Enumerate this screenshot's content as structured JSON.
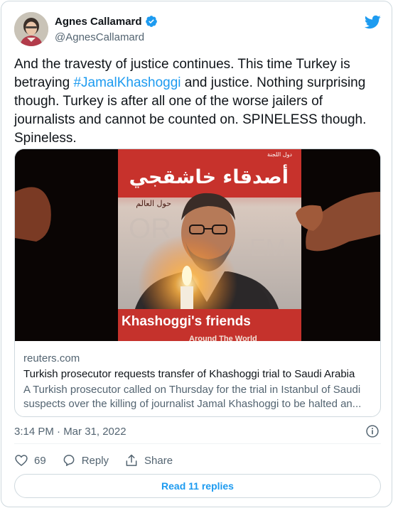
{
  "author": {
    "name": "Agnes Callamard",
    "handle": "@AgnesCallamard",
    "verified": true
  },
  "tweet": {
    "text_part1": "And the travesty of justice continues. This time Turkey is betraying ",
    "hashtag": "#JamalKhashoggi",
    "text_part2": " and justice. Nothing surprising though. Turkey is after all one of the worse jailers of journalists and cannot be counted on.  SPINELESS though. Spineless."
  },
  "link_card": {
    "photo": {
      "poster_arabic_title": "أصدقاء خاشقجي",
      "poster_arabic_sub": "حول العالم",
      "poster_arabic_top": "دول اللجنة",
      "poster_english_title": "Khashoggi's friends",
      "poster_english_sub": "Around The World"
    },
    "domain": "reuters.com",
    "title": "Turkish prosecutor requests transfer of Khashoggi trial to Saudi Arabia",
    "description_line1": "A Turkish prosecutor called on Thursday for the trial in Istanbul of Saudi",
    "description_line2": "suspects over the killing of journalist Jamal Khashoggi to be halted an..."
  },
  "timestamp": "3:14 PM · Mar 31, 2022",
  "actions": {
    "like_count": "69",
    "reply_label": "Reply",
    "share_label": "Share"
  },
  "read_replies_label": "Read 11 replies",
  "colors": {
    "accent": "#1d9bf0",
    "secondary_text": "#536471",
    "border": "#cfd9de"
  },
  "icons": [
    "verified-badge-icon",
    "twitter-bird-icon",
    "info-icon",
    "heart-icon",
    "reply-icon",
    "share-icon"
  ]
}
